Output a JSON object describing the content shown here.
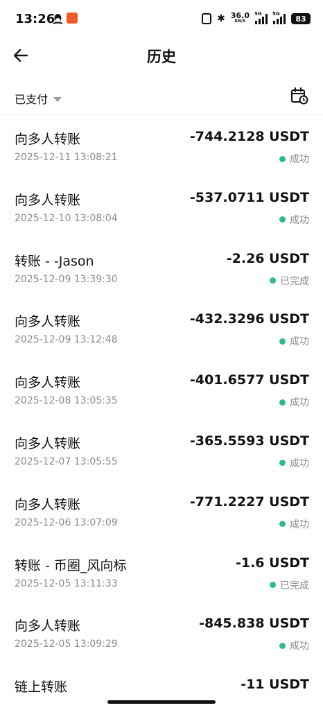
{
  "statusbar": {
    "time": "13:26",
    "net_speed_value": "36.0",
    "net_speed_unit": "KB/S",
    "sim1_tag": "5G",
    "sim2_tag": "5G",
    "battery": "83"
  },
  "header": {
    "title": "历史"
  },
  "filter": {
    "label": "已支付"
  },
  "colors": {
    "success_dot": "#2dbd84",
    "secondary_text": "#8a8a8a"
  },
  "transactions": [
    {
      "title": "向多人转账",
      "time": "2025-12-11 13:08:21",
      "amount": "-744.2128 USDT",
      "status": "成功"
    },
    {
      "title": "向多人转账",
      "time": "2025-12-10 13:08:04",
      "amount": "-537.0711 USDT",
      "status": "成功"
    },
    {
      "title": "转账 - -Jason",
      "time": "2025-12-09 13:39:30",
      "amount": "-2.26 USDT",
      "status": "已完成"
    },
    {
      "title": "向多人转账",
      "time": "2025-12-09 13:12:48",
      "amount": "-432.3296 USDT",
      "status": "成功"
    },
    {
      "title": "向多人转账",
      "time": "2025-12-08 13:05:35",
      "amount": "-401.6577 USDT",
      "status": "成功"
    },
    {
      "title": "向多人转账",
      "time": "2025-12-07 13:05:55",
      "amount": "-365.5593 USDT",
      "status": "成功"
    },
    {
      "title": "向多人转账",
      "time": "2025-12-06 13:07:09",
      "amount": "-771.2227 USDT",
      "status": "成功"
    },
    {
      "title": "转账 - 币圈_风向标",
      "time": "2025-12-05 13:11:33",
      "amount": "-1.6 USDT",
      "status": "已完成"
    },
    {
      "title": "向多人转账",
      "time": "2025-12-05 13:09:29",
      "amount": "-845.838 USDT",
      "status": "成功"
    },
    {
      "title": "链上转账",
      "time": "",
      "amount": "-11 USDT",
      "status": ""
    }
  ]
}
